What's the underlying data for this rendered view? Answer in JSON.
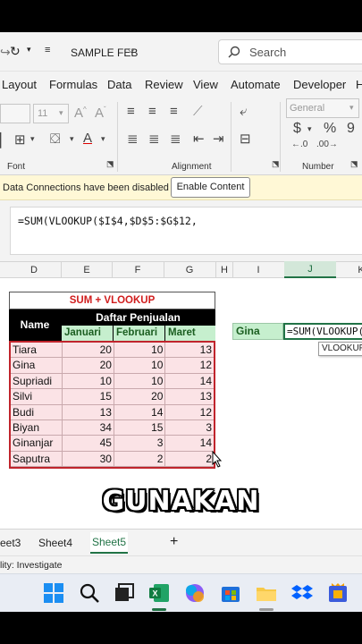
{
  "window": {
    "file_name": "SAMPLE FEB",
    "search_placeholder": "Search"
  },
  "ribbon_tabs": [
    "Layout",
    "Formulas",
    "Data",
    "Review",
    "View",
    "Automate",
    "Developer",
    "H"
  ],
  "ribbon": {
    "font_size": "11",
    "number_format": "General",
    "group_font": "Font",
    "group_alignment": "Alignment",
    "group_number": "Number"
  },
  "message_bar": {
    "text": "Data Connections have been disabled",
    "button": "Enable Content"
  },
  "formula_bar": {
    "content": "=SUM(VLOOKUP($I$4,$D$5:$G$12,"
  },
  "columns": [
    "D",
    "E",
    "F",
    "G",
    "H",
    "I",
    "J",
    "K"
  ],
  "table": {
    "title": "SUM + VLOOKUP",
    "name_header": "Name",
    "group_header": "Daftar Penjualan",
    "months": [
      "Januari",
      "Februari",
      "Maret"
    ],
    "rows": [
      {
        "name": "Tiara",
        "values": [
          20,
          10,
          13
        ]
      },
      {
        "name": "Gina",
        "values": [
          20,
          10,
          12
        ]
      },
      {
        "name": "Supriadi",
        "values": [
          10,
          10,
          14
        ]
      },
      {
        "name": "Silvi",
        "values": [
          15,
          20,
          13
        ]
      },
      {
        "name": "Budi",
        "values": [
          13,
          14,
          12
        ]
      },
      {
        "name": "Biyan",
        "values": [
          34,
          15,
          3
        ]
      },
      {
        "name": "Ginanjar",
        "values": [
          45,
          3,
          14
        ]
      },
      {
        "name": "Saputra",
        "values": [
          30,
          2,
          2
        ]
      }
    ]
  },
  "lookup": {
    "name": "Gina",
    "editing": "=SUM(VLOOKUP(",
    "tooltip": "VLOOKUP"
  },
  "caption": "GUNAKAN",
  "sheet_tabs": [
    "eet3",
    "Sheet4",
    "Sheet5"
  ],
  "add_sheet": "+",
  "status": "lity: Investigate",
  "colors": {
    "excel_green": "#217346",
    "accent_red": "#c0242c",
    "row_pink": "#fbe3e6",
    "month_green": "#c6efce"
  }
}
